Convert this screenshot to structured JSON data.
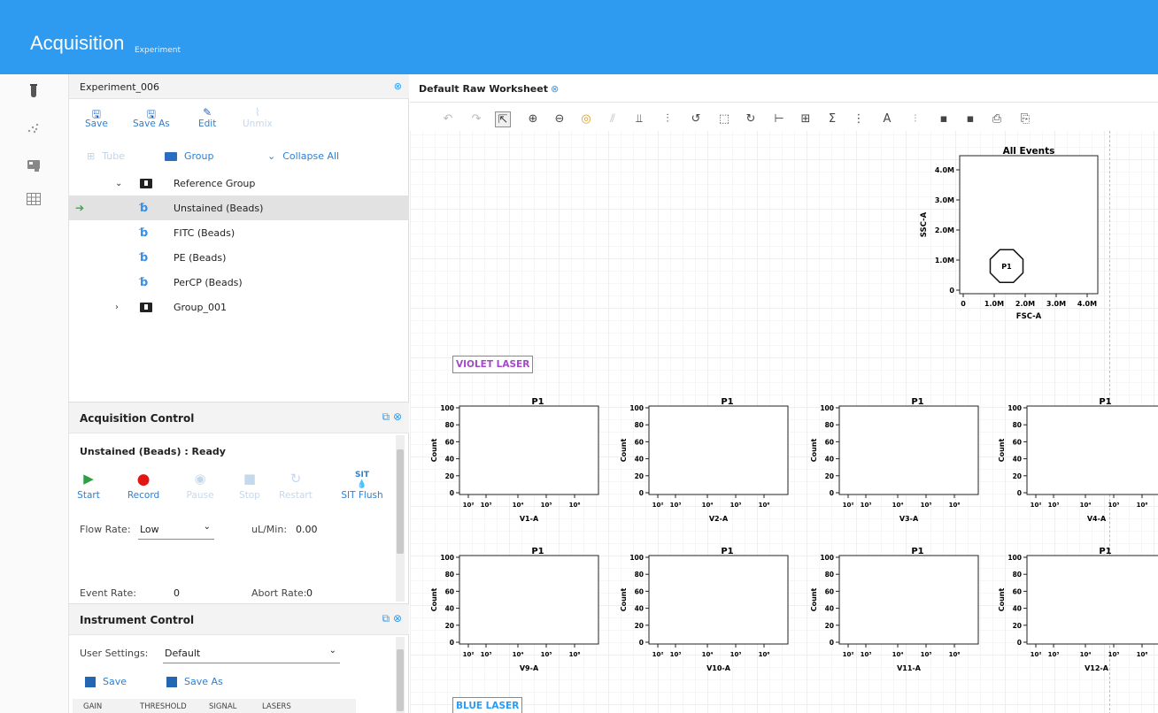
{
  "header": {
    "title": "Acquisition",
    "subtitle": "Experiment"
  },
  "rail": {
    "icons": [
      "tube-icon",
      "scatter-icon",
      "instrument-icon",
      "grid-icon"
    ]
  },
  "experiment": {
    "name": "Experiment_006",
    "toolbar": {
      "save": "Save",
      "save_as": "Save As",
      "edit": "Edit",
      "unmix": "Unmix"
    },
    "row2": {
      "tube": "Tube",
      "group": "Group",
      "collapse_all": "Collapse All"
    },
    "tree": {
      "reference_group": "Reference Group",
      "items": [
        "Unstained (Beads)",
        "FITC (Beads)",
        "PE (Beads)",
        "PerCP (Beads)"
      ],
      "group_001": "Group_001"
    }
  },
  "acquisition": {
    "title": "Acquisition Control",
    "status": "Unstained (Beads) : Ready",
    "buttons": {
      "start": "Start",
      "record": "Record",
      "pause": "Pause",
      "stop": "Stop",
      "restart": "Restart",
      "sit_flush": "SIT Flush",
      "sit_icon": "SIT"
    },
    "flow_rate_label": "Flow Rate:",
    "flow_rate_value": "Low",
    "ul_min_label": "uL/Min:",
    "ul_min_value": "0.00",
    "event_rate_label": "Event Rate:",
    "event_rate_value": "0",
    "abort_rate_label": "Abort Rate:",
    "abort_rate_value": "0"
  },
  "instrument": {
    "title": "Instrument Control",
    "user_settings_label": "User Settings:",
    "user_settings_value": "Default",
    "save": "Save",
    "save_as": "Save As",
    "tabs": [
      "GAIN",
      "THRESHOLD",
      "SIGNAL",
      "LASERS"
    ]
  },
  "worksheet": {
    "tab": "Default Raw Worksheet",
    "violet_label": "VIOLET LASER",
    "blue_label": "BLUE LASER",
    "colors": {
      "accent": "#2e9af0",
      "violet": "#a24bc4",
      "blue": "#2e9af0"
    }
  },
  "chart_data": [
    {
      "type": "scatter",
      "title": "All Events",
      "xlabel": "FSC-A",
      "ylabel": "SSC-A",
      "xticks": [
        "0",
        "1.0M",
        "2.0M",
        "3.0M",
        "4.0M"
      ],
      "yticks": [
        "0",
        "1.0M",
        "2.0M",
        "3.0M",
        "4.0M"
      ],
      "xlim": [
        0,
        4000000
      ],
      "ylim": [
        0,
        4000000
      ],
      "gate": {
        "name": "P1",
        "center": [
          1400000,
          800000
        ]
      },
      "points": []
    },
    {
      "type": "bar",
      "title": "P1",
      "xlabel": "V1-A",
      "ylabel": "Count",
      "yticks": [
        "0",
        "20",
        "40",
        "60",
        "80",
        "100"
      ],
      "xticks": [
        "10²",
        "10³",
        "10⁴",
        "10⁵",
        "10⁶"
      ],
      "values": []
    },
    {
      "type": "bar",
      "title": "P1",
      "xlabel": "V2-A",
      "ylabel": "Count",
      "yticks": [
        "0",
        "20",
        "40",
        "60",
        "80",
        "100"
      ],
      "xticks": [
        "10²",
        "10³",
        "10⁴",
        "10⁵",
        "10⁶"
      ],
      "values": []
    },
    {
      "type": "bar",
      "title": "P1",
      "xlabel": "V3-A",
      "ylabel": "Count",
      "yticks": [
        "0",
        "20",
        "40",
        "60",
        "80",
        "100"
      ],
      "xticks": [
        "10²",
        "10³",
        "10⁴",
        "10⁵",
        "10⁶"
      ],
      "values": []
    },
    {
      "type": "bar",
      "title": "P1",
      "xlabel": "V4-A",
      "ylabel": "Count",
      "yticks": [
        "0",
        "20",
        "40",
        "60",
        "80",
        "100"
      ],
      "xticks": [
        "10²",
        "10³",
        "10⁴",
        "10⁵",
        "10⁶"
      ],
      "values": []
    },
    {
      "type": "bar",
      "title": "P1",
      "xlabel": "V9-A",
      "ylabel": "Count",
      "yticks": [
        "0",
        "20",
        "40",
        "60",
        "80",
        "100"
      ],
      "xticks": [
        "10²",
        "10³",
        "10⁴",
        "10⁵",
        "10⁶"
      ],
      "values": []
    },
    {
      "type": "bar",
      "title": "P1",
      "xlabel": "V10-A",
      "ylabel": "Count",
      "yticks": [
        "0",
        "20",
        "40",
        "60",
        "80",
        "100"
      ],
      "xticks": [
        "10²",
        "10³",
        "10⁴",
        "10⁵",
        "10⁶"
      ],
      "values": []
    },
    {
      "type": "bar",
      "title": "P1",
      "xlabel": "V11-A",
      "ylabel": "Count",
      "yticks": [
        "0",
        "20",
        "40",
        "60",
        "80",
        "100"
      ],
      "xticks": [
        "10²",
        "10³",
        "10⁴",
        "10⁵",
        "10⁶"
      ],
      "values": []
    },
    {
      "type": "bar",
      "title": "P1",
      "xlabel": "V12-A",
      "ylabel": "Count",
      "yticks": [
        "0",
        "20",
        "40",
        "60",
        "80",
        "100"
      ],
      "xticks": [
        "10²",
        "10³",
        "10⁴",
        "10⁵",
        "10⁶"
      ],
      "values": []
    }
  ]
}
